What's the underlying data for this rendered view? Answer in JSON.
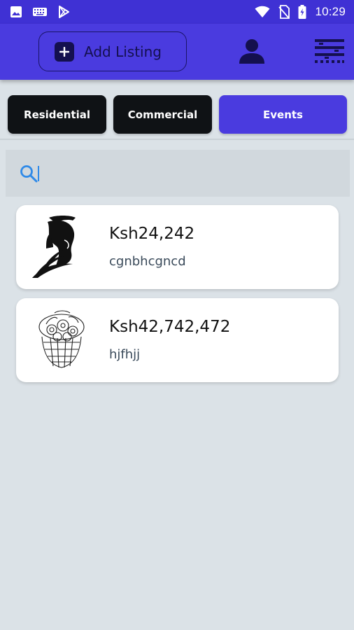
{
  "status_bar": {
    "time": "10:29",
    "left_icons": [
      "image-icon",
      "keyboard-icon",
      "play-store-icon"
    ],
    "right_icons": [
      "wifi-icon",
      "no-sim-icon",
      "battery-charging-icon"
    ]
  },
  "app_bar": {
    "add_listing_label": "Add Listing",
    "icons": [
      "plus-icon",
      "person-icon",
      "filter-icon"
    ]
  },
  "tabs": [
    {
      "label": "Residential",
      "selected": false
    },
    {
      "label": "Commercial",
      "selected": false
    },
    {
      "label": "Events",
      "selected": true
    }
  ],
  "search": {
    "value": "",
    "placeholder": ""
  },
  "listings": [
    {
      "price": "Ksh24,242",
      "title": "cgnbhcgncd",
      "thumbnail_icon": "spartan-helmet-icon"
    },
    {
      "price": "Ksh42,742,472",
      "title": "hjfhjj",
      "thumbnail_icon": "flower-basket-icon"
    }
  ],
  "colors": {
    "status_bar": "#3f31d4",
    "app_bar": "#4a3bdf",
    "tab_dark": "#0f1215",
    "tab_selected": "#4a3bdf",
    "background": "#dbe2e7",
    "search_accent": "#2f8ae8"
  }
}
